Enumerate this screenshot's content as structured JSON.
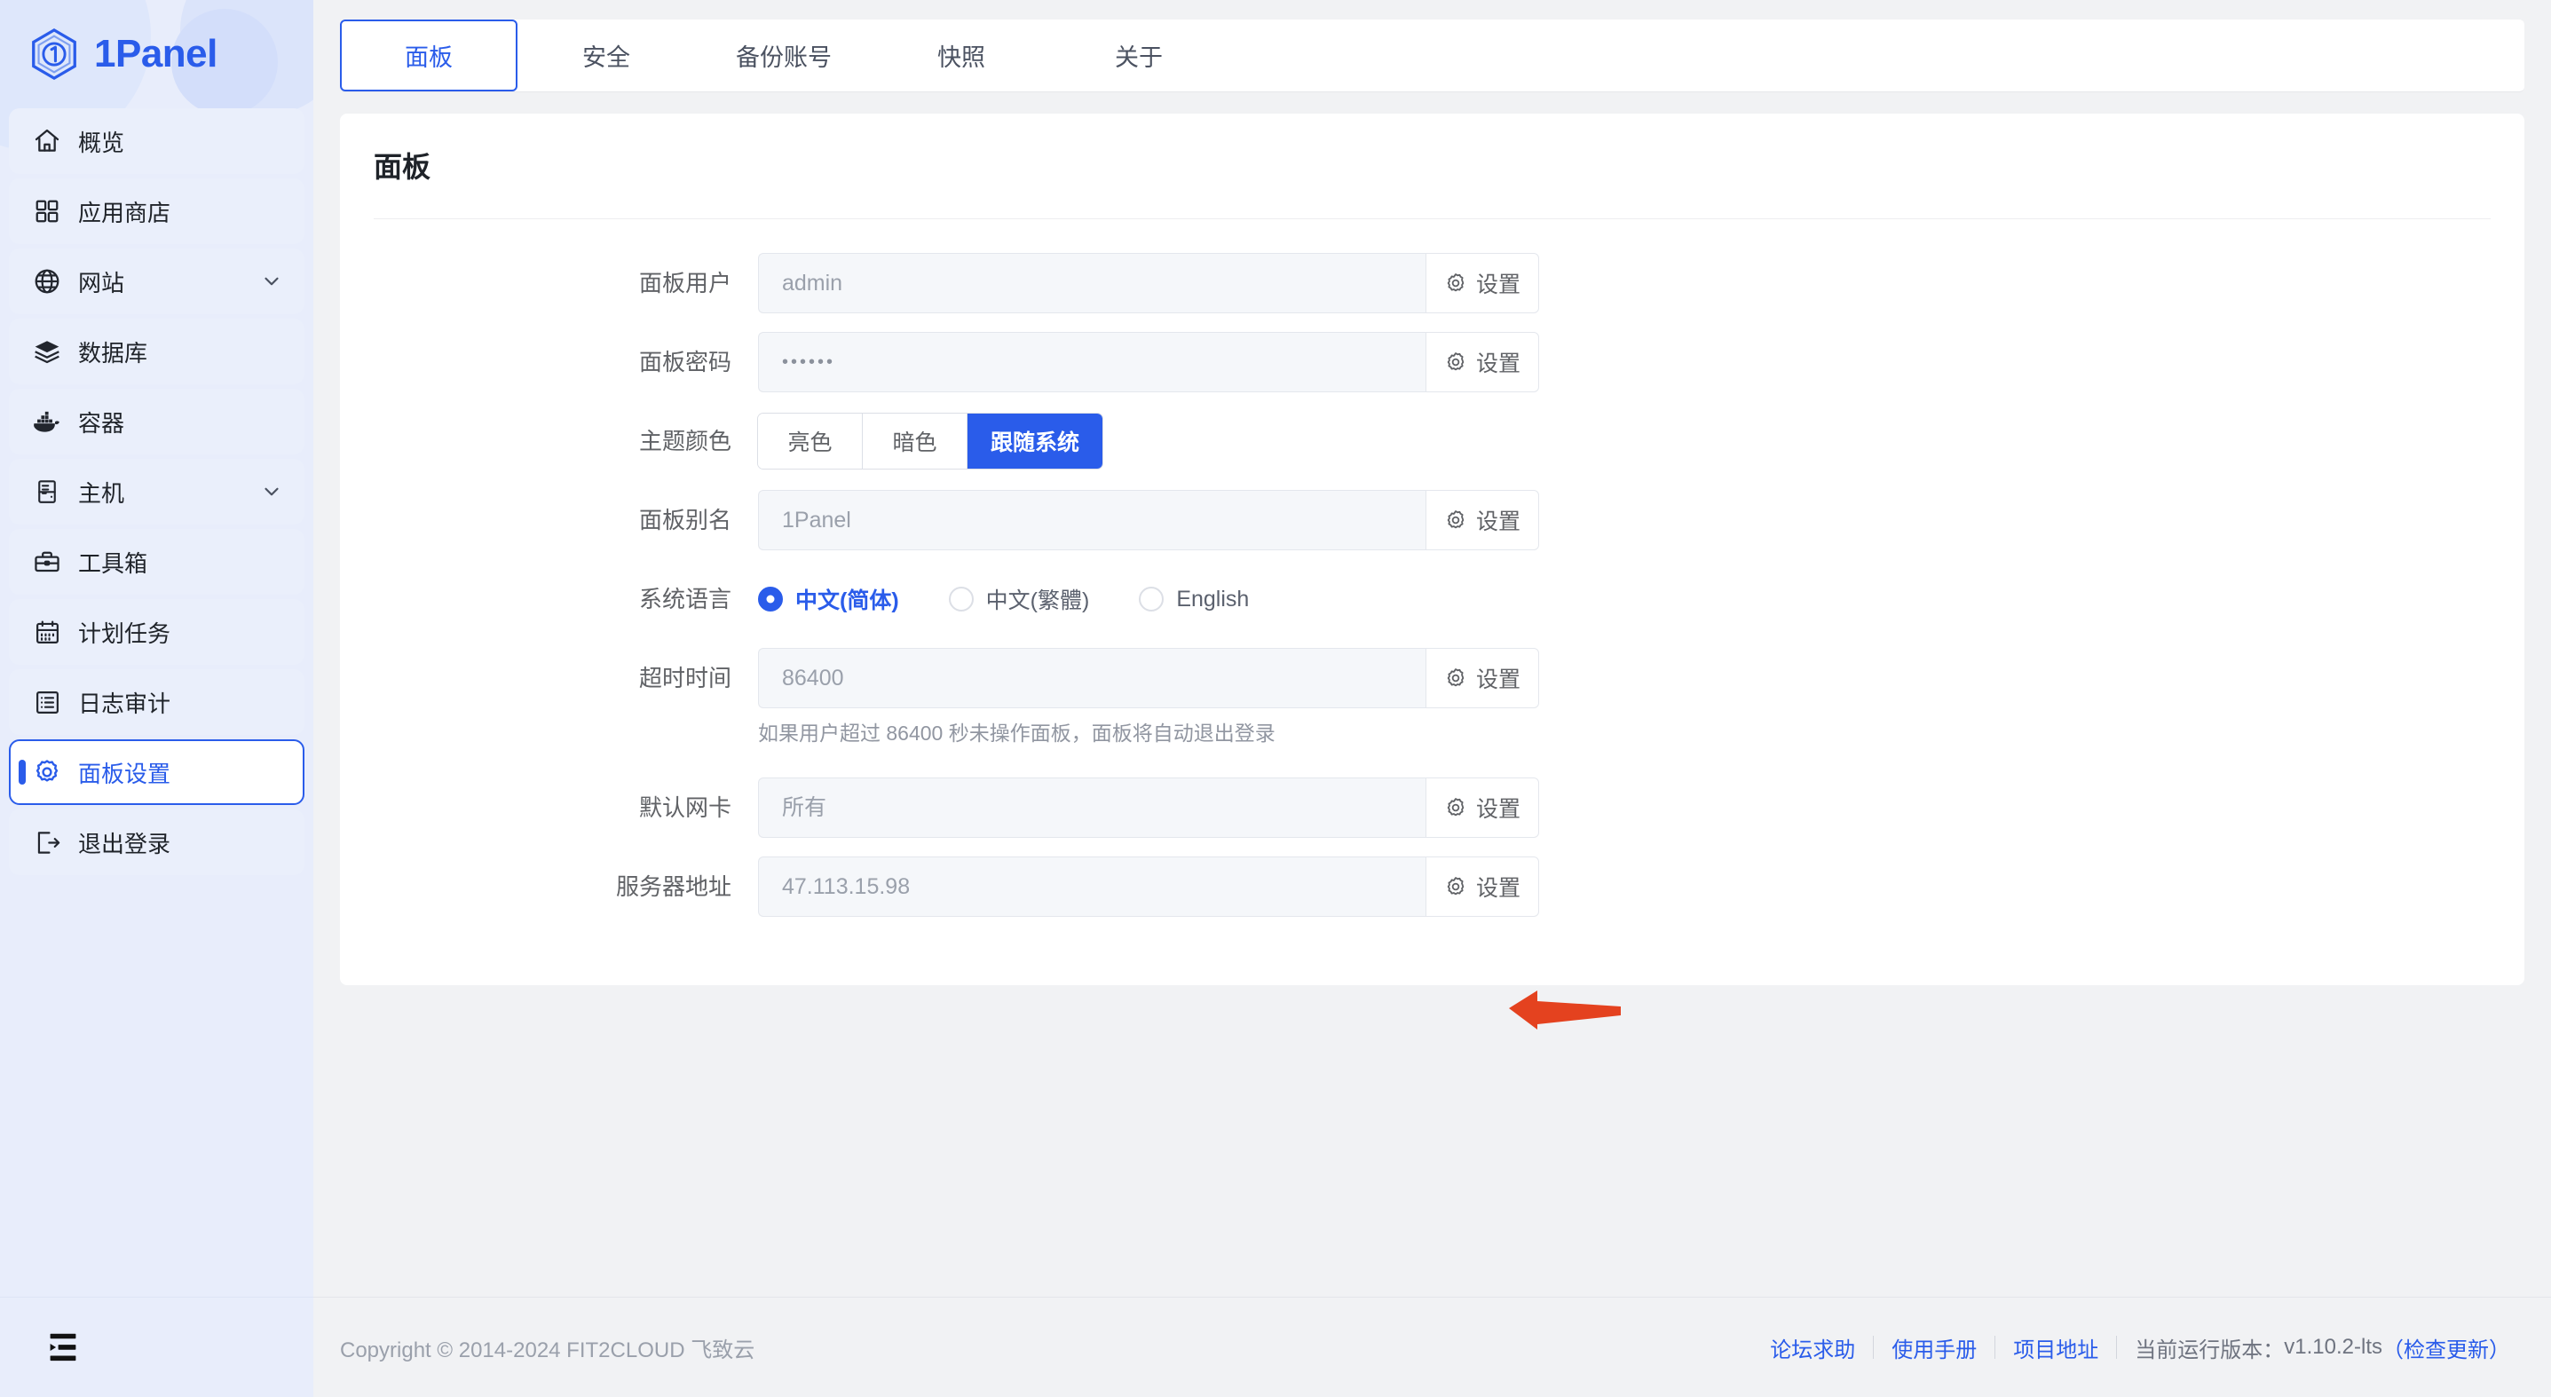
{
  "brand": {
    "name": "1Panel",
    "logo_icon": "1panel-hexagon-logo"
  },
  "sidebar": {
    "items": [
      {
        "label": "概览",
        "icon": "home-icon",
        "expandable": false,
        "active": false
      },
      {
        "label": "应用商店",
        "icon": "apps-grid-icon",
        "expandable": false,
        "active": false
      },
      {
        "label": "网站",
        "icon": "globe-icon",
        "expandable": true,
        "active": false
      },
      {
        "label": "数据库",
        "icon": "database-icon",
        "expandable": false,
        "active": false
      },
      {
        "label": "容器",
        "icon": "docker-whale-icon",
        "expandable": false,
        "active": false
      },
      {
        "label": "主机",
        "icon": "server-icon",
        "expandable": true,
        "active": false
      },
      {
        "label": "工具箱",
        "icon": "toolbox-icon",
        "expandable": false,
        "active": false
      },
      {
        "label": "计划任务",
        "icon": "calendar-icon",
        "expandable": false,
        "active": false
      },
      {
        "label": "日志审计",
        "icon": "list-box-icon",
        "expandable": false,
        "active": false
      },
      {
        "label": "面板设置",
        "icon": "gear-icon",
        "expandable": false,
        "active": true
      },
      {
        "label": "退出登录",
        "icon": "logout-icon",
        "expandable": false,
        "active": false
      }
    ],
    "collapse_icon": "menu-fold-icon"
  },
  "tabs": [
    {
      "label": "面板",
      "active": true
    },
    {
      "label": "安全",
      "active": false
    },
    {
      "label": "备份账号",
      "active": false
    },
    {
      "label": "快照",
      "active": false
    },
    {
      "label": "关于",
      "active": false
    }
  ],
  "panel": {
    "title": "面板",
    "settings_button_label": "设置",
    "settings_icon": "gear-icon",
    "rows": {
      "user": {
        "label": "面板用户",
        "value": "admin"
      },
      "password": {
        "label": "面板密码",
        "value": "••••••"
      },
      "theme": {
        "label": "主题颜色",
        "options": [
          "亮色",
          "暗色",
          "跟随系统"
        ],
        "selected": "跟随系统"
      },
      "alias": {
        "label": "面板别名",
        "value": "1Panel"
      },
      "language": {
        "label": "系统语言",
        "options": [
          "中文(简体)",
          "中文(繁體)",
          "English"
        ],
        "selected": "中文(简体)"
      },
      "timeout": {
        "label": "超时时间",
        "value": "86400",
        "hint": "如果用户超过 86400 秒未操作面板，面板将自动退出登录"
      },
      "nic": {
        "label": "默认网卡",
        "value": "所有"
      },
      "server_address": {
        "label": "服务器地址",
        "value": "47.113.15.98"
      }
    }
  },
  "footer": {
    "copyright": "Copyright © 2014-2024 FIT2CLOUD 飞致云",
    "links": [
      "论坛求助",
      "使用手册",
      "项目地址"
    ],
    "version_label": "当前运行版本：",
    "version": "v1.10.2-lts",
    "update_label": "（检查更新）"
  },
  "annotation": {
    "arrow_color": "#e4421f",
    "points_to": "服务器地址 设置 按钮"
  },
  "colors": {
    "accent": "#2a5cea",
    "sidebar_bg": "#e8edfb",
    "page_bg": "#f1f2f4",
    "card_bg": "#ffffff",
    "input_bg": "#f5f7fa",
    "arrow_red": "#e4421f"
  }
}
